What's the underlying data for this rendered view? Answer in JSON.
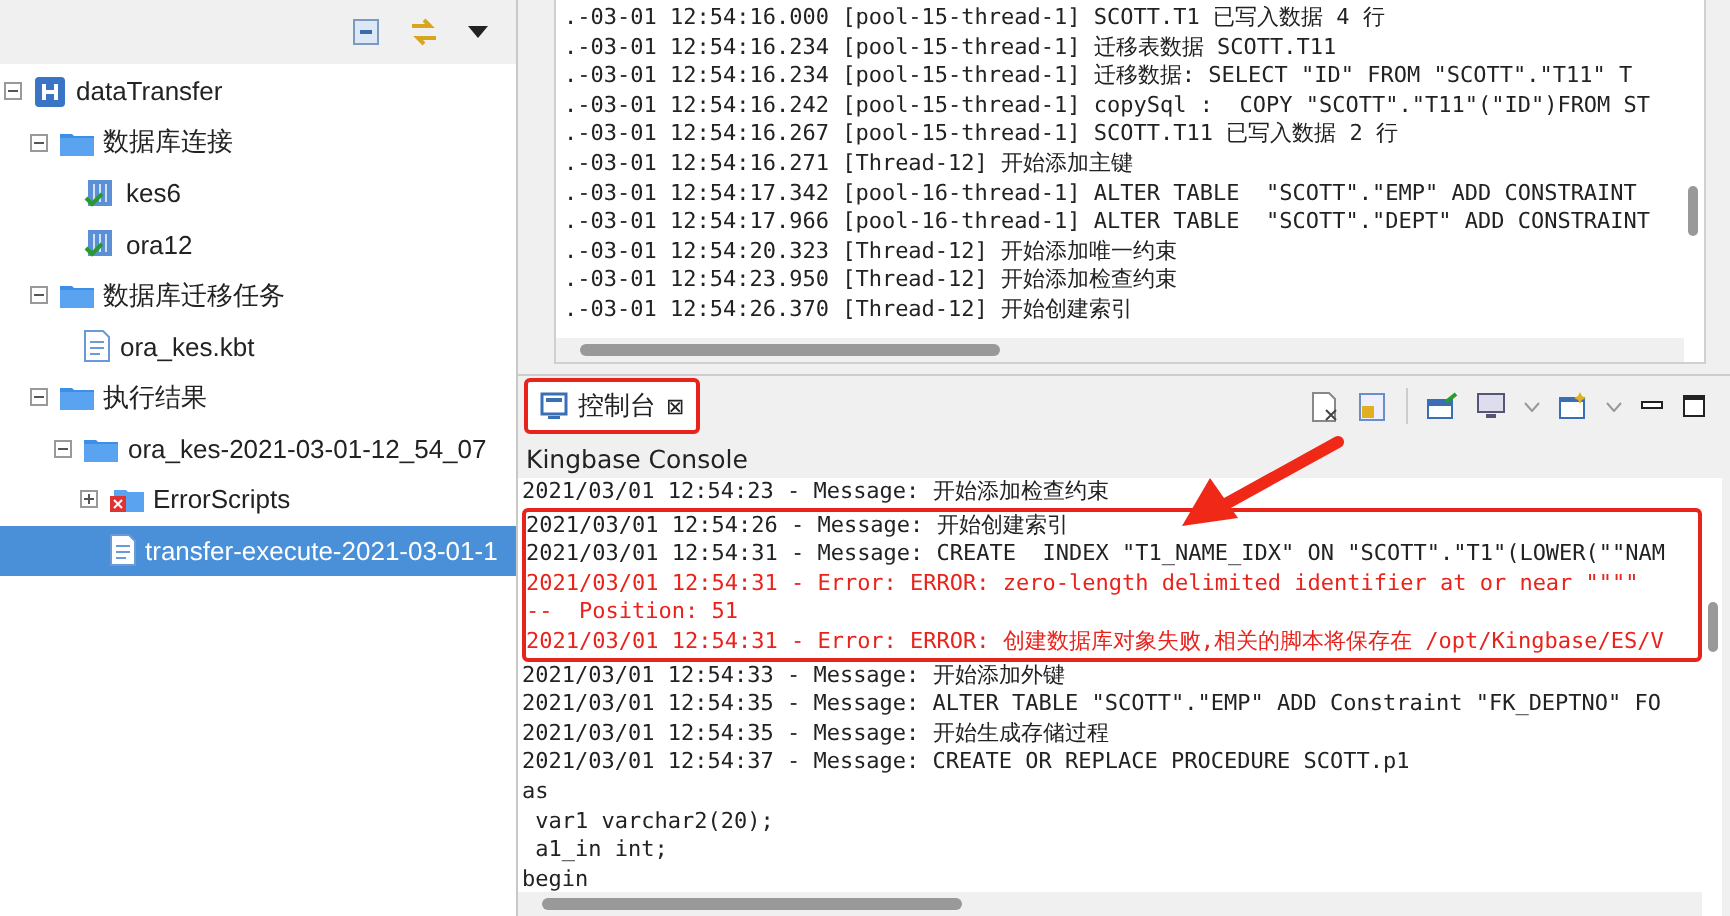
{
  "navigator": {
    "tree": [
      {
        "label": "dataTransfer",
        "kind": "project",
        "expanded": true,
        "selected": false,
        "children": [
          {
            "label": "数据库连接",
            "kind": "folder",
            "expanded": true,
            "selected": false,
            "children": [
              {
                "label": "kes6",
                "kind": "connection",
                "selected": false
              },
              {
                "label": "ora12",
                "kind": "connection",
                "selected": false
              }
            ]
          },
          {
            "label": "数据库迁移任务",
            "kind": "folder",
            "expanded": true,
            "selected": false,
            "children": [
              {
                "label": "ora_kes.kbt",
                "kind": "file",
                "selected": false
              }
            ]
          },
          {
            "label": "执行结果",
            "kind": "folder",
            "expanded": true,
            "selected": false,
            "children": [
              {
                "label": "ora_kes-2021-03-01-12_54_07",
                "kind": "folder",
                "expanded": true,
                "selected": false,
                "children": [
                  {
                    "label": "ErrorScripts",
                    "kind": "error-folder",
                    "expanded": false,
                    "selected": false
                  },
                  {
                    "label": "transfer-execute-2021-03-01-1",
                    "kind": "file",
                    "selected": true
                  }
                ]
              }
            ]
          }
        ]
      }
    ]
  },
  "log": {
    "lines": [
      ".-03-01 12:54:16.000 [pool-15-thread-1] SCOTT.T1 已写入数据 4 行",
      ".-03-01 12:54:16.234 [pool-15-thread-1] 迁移表数据 SCOTT.T11",
      ".-03-01 12:54:16.234 [pool-15-thread-1] 迁移数据: SELECT \"ID\" FROM \"SCOTT\".\"T11\" T",
      ".-03-01 12:54:16.242 [pool-15-thread-1] copySql :  COPY \"SCOTT\".\"T11\"(\"ID\")FROM ST",
      ".-03-01 12:54:16.267 [pool-15-thread-1] SCOTT.T11 已写入数据 2 行",
      ".-03-01 12:54:16.271 [Thread-12] 开始添加主键",
      ".-03-01 12:54:17.342 [pool-16-thread-1] ALTER TABLE  \"SCOTT\".\"EMP\" ADD CONSTRAINT",
      ".-03-01 12:54:17.966 [pool-16-thread-1] ALTER TABLE  \"SCOTT\".\"DEPT\" ADD CONSTRAINT",
      ".-03-01 12:54:20.323 [Thread-12] 开始添加唯一约束",
      ".-03-01 12:54:23.950 [Thread-12] 开始添加检查约束",
      ".-03-01 12:54:26.370 [Thread-12] 开始创建索引"
    ]
  },
  "console": {
    "tab": {
      "label": "控制台",
      "close": "⊠",
      "selected": true,
      "highlighted": true
    },
    "title": "Kingbase Console",
    "lines": [
      {
        "text": "2021/03/01 12:54:23 - Message: 开始添加检查约束",
        "kind": "message",
        "highlighted": false
      },
      {
        "text": "2021/03/01 12:54:26 - Message: 开始创建索引",
        "kind": "message",
        "highlighted": true
      },
      {
        "text": "2021/03/01 12:54:31 - Message: CREATE  INDEX \"T1_NAME_IDX\" ON \"SCOTT\".\"T1\"(LOWER(\"\"NAM",
        "kind": "message",
        "highlighted": true
      },
      {
        "text": "2021/03/01 12:54:31 - Error: ERROR: zero-length delimited identifier at or near \"\"\"\"",
        "kind": "error",
        "highlighted": true
      },
      {
        "text": "--  Position: 51",
        "kind": "error",
        "highlighted": true
      },
      {
        "text": "2021/03/01 12:54:31 - Error: ERROR: 创建数据库对象失败,相关的脚本将保存在 /opt/Kingbase/ES/V",
        "kind": "error",
        "highlighted": true
      },
      {
        "text": "2021/03/01 12:54:33 - Message: 开始添加外键",
        "kind": "message",
        "highlighted": false
      },
      {
        "text": "2021/03/01 12:54:35 - Message: ALTER TABLE \"SCOTT\".\"EMP\" ADD Constraint \"FK_DEPTNO\" FO",
        "kind": "message",
        "highlighted": false
      },
      {
        "text": "2021/03/01 12:54:35 - Message: 开始生成存储过程",
        "kind": "message",
        "highlighted": false
      },
      {
        "text": "2021/03/01 12:54:37 - Message: CREATE OR REPLACE PROCEDURE SCOTT.p1",
        "kind": "message",
        "highlighted": false
      },
      {
        "text": "as",
        "kind": "message",
        "highlighted": false
      },
      {
        "text": " var1 varchar2(20);",
        "kind": "message",
        "highlighted": false
      },
      {
        "text": " a1_in int;",
        "kind": "message",
        "highlighted": false
      },
      {
        "text": "begin",
        "kind": "message",
        "highlighted": false
      }
    ]
  }
}
